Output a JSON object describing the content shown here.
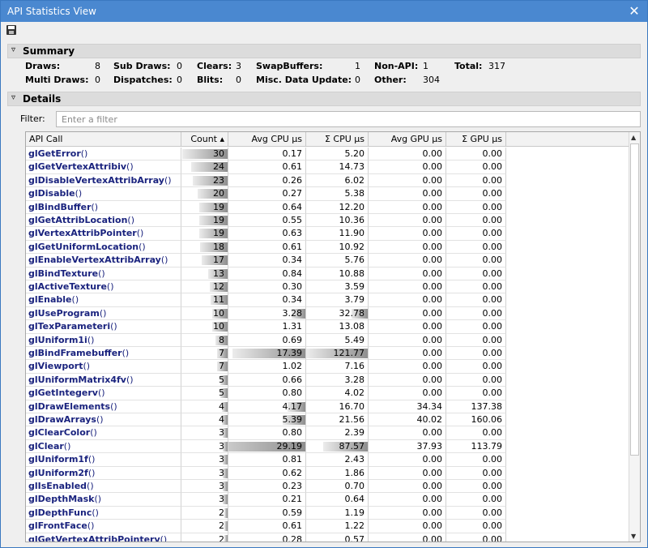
{
  "window": {
    "title": "API Statistics View",
    "close_glyph": "✕"
  },
  "toolbar": {
    "save_icon": "save-icon"
  },
  "summary": {
    "header": "Summary",
    "items": [
      {
        "label": "Draws:",
        "value": "8"
      },
      {
        "label": "Sub Draws:",
        "value": "0"
      },
      {
        "label": "Clears:",
        "value": "3"
      },
      {
        "label": "SwapBuffers:",
        "value": "1"
      },
      {
        "label": "Non-API:",
        "value": "1"
      },
      {
        "label": "Total:",
        "value": "317"
      },
      {
        "label": "Multi Draws:",
        "value": "0"
      },
      {
        "label": "Dispatches:",
        "value": "0"
      },
      {
        "label": "Blits:",
        "value": "0"
      },
      {
        "label": "Misc. Data Update:",
        "value": "0"
      },
      {
        "label": "Other:",
        "value": "304"
      }
    ]
  },
  "details": {
    "header": "Details",
    "filter_label": "Filter:",
    "filter_placeholder": "Enter a filter",
    "columns": [
      "API Call",
      "Count ▴",
      "Avg CPU µs",
      "Σ CPU µs",
      "Avg GPU µs",
      "Σ GPU µs"
    ],
    "max_count": 30,
    "max_avg_cpu": 17.39,
    "max_sum_cpu": 121.77,
    "rows": [
      {
        "name": "glGetError",
        "args": "()",
        "count": "30",
        "avg_cpu": "0.17",
        "sum_cpu": "5.20",
        "avg_gpu": "0.00",
        "sum_gpu": "0.00"
      },
      {
        "name": "glGetVertexAttribiv",
        "args": "()",
        "count": "24",
        "avg_cpu": "0.61",
        "sum_cpu": "14.73",
        "avg_gpu": "0.00",
        "sum_gpu": "0.00"
      },
      {
        "name": "glDisableVertexAttribArray",
        "args": "()",
        "count": "23",
        "avg_cpu": "0.26",
        "sum_cpu": "6.02",
        "avg_gpu": "0.00",
        "sum_gpu": "0.00"
      },
      {
        "name": "glDisable",
        "args": "()",
        "count": "20",
        "avg_cpu": "0.27",
        "sum_cpu": "5.38",
        "avg_gpu": "0.00",
        "sum_gpu": "0.00"
      },
      {
        "name": "glBindBuffer",
        "args": "()",
        "count": "19",
        "avg_cpu": "0.64",
        "sum_cpu": "12.20",
        "avg_gpu": "0.00",
        "sum_gpu": "0.00"
      },
      {
        "name": "glGetAttribLocation",
        "args": "()",
        "count": "19",
        "avg_cpu": "0.55",
        "sum_cpu": "10.36",
        "avg_gpu": "0.00",
        "sum_gpu": "0.00"
      },
      {
        "name": "glVertexAttribPointer",
        "args": "()",
        "count": "19",
        "avg_cpu": "0.63",
        "sum_cpu": "11.90",
        "avg_gpu": "0.00",
        "sum_gpu": "0.00"
      },
      {
        "name": "glGetUniformLocation",
        "args": "()",
        "count": "18",
        "avg_cpu": "0.61",
        "sum_cpu": "10.92",
        "avg_gpu": "0.00",
        "sum_gpu": "0.00"
      },
      {
        "name": "glEnableVertexAttribArray",
        "args": "()",
        "count": "17",
        "avg_cpu": "0.34",
        "sum_cpu": "5.76",
        "avg_gpu": "0.00",
        "sum_gpu": "0.00"
      },
      {
        "name": "glBindTexture",
        "args": "()",
        "count": "13",
        "avg_cpu": "0.84",
        "sum_cpu": "10.88",
        "avg_gpu": "0.00",
        "sum_gpu": "0.00"
      },
      {
        "name": "glActiveTexture",
        "args": "()",
        "count": "12",
        "avg_cpu": "0.30",
        "sum_cpu": "3.59",
        "avg_gpu": "0.00",
        "sum_gpu": "0.00"
      },
      {
        "name": "glEnable",
        "args": "()",
        "count": "11",
        "avg_cpu": "0.34",
        "sum_cpu": "3.79",
        "avg_gpu": "0.00",
        "sum_gpu": "0.00"
      },
      {
        "name": "glUseProgram",
        "args": "()",
        "count": "10",
        "avg_cpu": "3.28",
        "sum_cpu": "32.78",
        "avg_gpu": "0.00",
        "sum_gpu": "0.00"
      },
      {
        "name": "glTexParameteri",
        "args": "()",
        "count": "10",
        "avg_cpu": "1.31",
        "sum_cpu": "13.08",
        "avg_gpu": "0.00",
        "sum_gpu": "0.00"
      },
      {
        "name": "glUniform1i",
        "args": "()",
        "count": "8",
        "avg_cpu": "0.69",
        "sum_cpu": "5.49",
        "avg_gpu": "0.00",
        "sum_gpu": "0.00"
      },
      {
        "name": "glBindFramebuffer",
        "args": "()",
        "count": "7",
        "avg_cpu": "17.39",
        "sum_cpu": "121.77",
        "avg_gpu": "0.00",
        "sum_gpu": "0.00"
      },
      {
        "name": "glViewport",
        "args": "()",
        "count": "7",
        "avg_cpu": "1.02",
        "sum_cpu": "7.16",
        "avg_gpu": "0.00",
        "sum_gpu": "0.00"
      },
      {
        "name": "glUniformMatrix4fv",
        "args": "()",
        "count": "5",
        "avg_cpu": "0.66",
        "sum_cpu": "3.28",
        "avg_gpu": "0.00",
        "sum_gpu": "0.00"
      },
      {
        "name": "glGetIntegerv",
        "args": "()",
        "count": "5",
        "avg_cpu": "0.80",
        "sum_cpu": "4.02",
        "avg_gpu": "0.00",
        "sum_gpu": "0.00"
      },
      {
        "name": "glDrawElements",
        "args": "()",
        "count": "4",
        "avg_cpu": "4.17",
        "sum_cpu": "16.70",
        "avg_gpu": "34.34",
        "sum_gpu": "137.38"
      },
      {
        "name": "glDrawArrays",
        "args": "()",
        "count": "4",
        "avg_cpu": "5.39",
        "sum_cpu": "21.56",
        "avg_gpu": "40.02",
        "sum_gpu": "160.06"
      },
      {
        "name": "glClearColor",
        "args": "()",
        "count": "3",
        "avg_cpu": "0.80",
        "sum_cpu": "2.39",
        "avg_gpu": "0.00",
        "sum_gpu": "0.00"
      },
      {
        "name": "glClear",
        "args": "()",
        "count": "3",
        "avg_cpu": "29.19",
        "sum_cpu": "87.57",
        "avg_gpu": "37.93",
        "sum_gpu": "113.79"
      },
      {
        "name": "glUniform1f",
        "args": "()",
        "count": "3",
        "avg_cpu": "0.81",
        "sum_cpu": "2.43",
        "avg_gpu": "0.00",
        "sum_gpu": "0.00"
      },
      {
        "name": "glUniform2f",
        "args": "()",
        "count": "3",
        "avg_cpu": "0.62",
        "sum_cpu": "1.86",
        "avg_gpu": "0.00",
        "sum_gpu": "0.00"
      },
      {
        "name": "glIsEnabled",
        "args": "()",
        "count": "3",
        "avg_cpu": "0.23",
        "sum_cpu": "0.70",
        "avg_gpu": "0.00",
        "sum_gpu": "0.00"
      },
      {
        "name": "glDepthMask",
        "args": "()",
        "count": "3",
        "avg_cpu": "0.21",
        "sum_cpu": "0.64",
        "avg_gpu": "0.00",
        "sum_gpu": "0.00"
      },
      {
        "name": "glDepthFunc",
        "args": "()",
        "count": "2",
        "avg_cpu": "0.59",
        "sum_cpu": "1.19",
        "avg_gpu": "0.00",
        "sum_gpu": "0.00"
      },
      {
        "name": "glFrontFace",
        "args": "()",
        "count": "2",
        "avg_cpu": "0.61",
        "sum_cpu": "1.22",
        "avg_gpu": "0.00",
        "sum_gpu": "0.00"
      },
      {
        "name": "glGetVertexAttribPointerv",
        "args": "()",
        "count": "2",
        "avg_cpu": "0.28",
        "sum_cpu": "0.57",
        "avg_gpu": "0.00",
        "sum_gpu": "0.00"
      }
    ]
  }
}
